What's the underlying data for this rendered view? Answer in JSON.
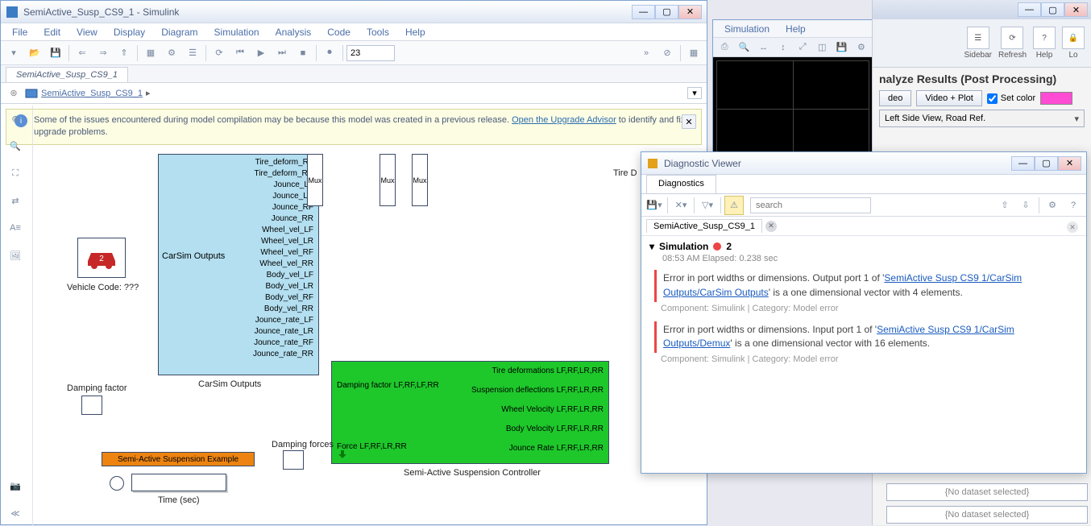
{
  "simulink": {
    "title": "SemiActive_Susp_CS9_1 - Simulink",
    "menus": [
      "File",
      "Edit",
      "View",
      "Display",
      "Diagram",
      "Simulation",
      "Analysis",
      "Code",
      "Tools",
      "Help"
    ],
    "stop_time": "23",
    "tab": "SemiActive_Susp_CS9_1",
    "breadcrumb": "SemiActive_Susp_CS9_1",
    "banner_pre": "Some of the issues encountered during model compilation may be because this model was created in a previous release. ",
    "banner_link": "Open the Upgrade Advisor",
    "banner_post": " to identify and fix upgrade problems."
  },
  "canvas": {
    "vehicle_label": "Vehicle Code: ???",
    "carsim_header": "CarSim Outputs",
    "carsim_caption": "CarSim Outputs",
    "ports": [
      "Tire_deform_RF",
      "Tire_deform_RR",
      "Jounce_LF",
      "Jounce_LR",
      "Jounce_RF",
      "Jounce_RR",
      "Wheel_vel_LF",
      "Wheel_vel_LR",
      "Wheel_vel_RF",
      "Wheel_vel_RR",
      "Body_vel_LF",
      "Body_vel_LR",
      "Body_vel_RF",
      "Body_vel_RR",
      "Jounce_rate_LF",
      "Jounce_rate_LR",
      "Jounce_rate_RF",
      "Jounce_rate_RR"
    ],
    "tire_d_label": "Tire D",
    "mux_label": "Mux",
    "damping_factor": "Damping factor",
    "damping_forces": "Damping forces",
    "annotation": "Semi-Active Suspension Example",
    "time_label": "Time (sec)",
    "controller": {
      "caption": "Semi-Active Suspension Controller",
      "in_damp": "Damping factor LF,RF,LF,RR",
      "in_force": "Force  LF,RF,LR,RR",
      "out": [
        "Tire deformations LF,RF,LR,RR",
        "Suspension deflections LF,RF,LR,RR",
        "Wheel Velocity LF,RF,LR,RR",
        "Body Velocity LF,RF,LR,RR",
        "Jounce Rate LF,RF,LR,RR"
      ]
    }
  },
  "scope": {
    "menus": [
      "Simulation",
      "Help"
    ]
  },
  "diag": {
    "title": "Diagnostic Viewer",
    "tab": "Diagnostics",
    "search_ph": "search",
    "model_tab": "SemiActive_Susp_CS9_1",
    "section": "Simulation",
    "count": "2",
    "timestamp": "08:53 AM   Elapsed: 0.238 sec",
    "msg1_pre": "Error in port widths or dimensions. Output port 1 of '",
    "msg1_link": "SemiActive Susp CS9 1/CarSim Outputs/CarSim Outputs",
    "msg1_post": "' is a one dimensional vector with 4 elements.",
    "msg2_pre": "Error in port widths or dimensions. Input port 1 of '",
    "msg2_link": "SemiActive Susp CS9 1/CarSim Outputs/Demux",
    "msg2_post": "' is a one dimensional vector with 16 elements.",
    "meta": "Component: Simulink | Category: Model error"
  },
  "right": {
    "tools": [
      "Sidebar",
      "Refresh",
      "Help",
      "Lo"
    ],
    "heading": "nalyze Results (Post Processing)",
    "btn_video": "deo",
    "btn_video_plot": "Video + Plot",
    "chk_setcolor": "Set color",
    "combo": "Left Side View, Road Ref.",
    "no_dataset": "{No dataset selected}"
  }
}
